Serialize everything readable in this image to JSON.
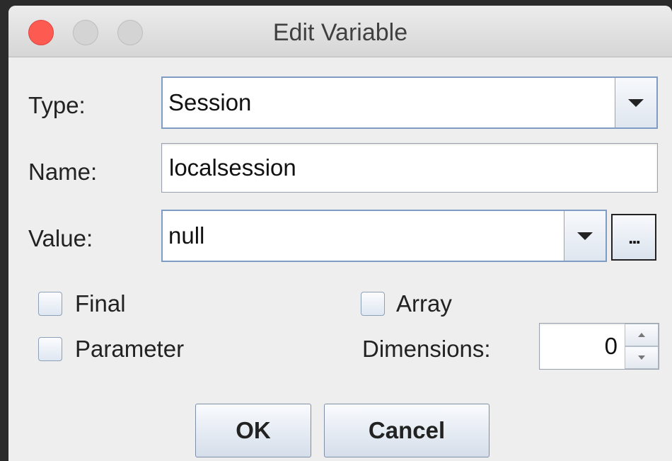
{
  "window": {
    "title": "Edit Variable"
  },
  "form": {
    "type_label": "Type:",
    "type_value": "Session",
    "name_label": "Name:",
    "name_value": "localsession",
    "value_label": "Value:",
    "value_value": "null",
    "ellipsis_label": "...",
    "final_label": "Final",
    "final_checked": false,
    "parameter_label": "Parameter",
    "parameter_checked": false,
    "array_label": "Array",
    "array_checked": false,
    "dimensions_label": "Dimensions:",
    "dimensions_value": "0"
  },
  "buttons": {
    "ok_label": "OK",
    "cancel_label": "Cancel"
  },
  "colors": {
    "close": "#fd5a52",
    "focus_border": "#7f9cc4"
  },
  "icons": {
    "dropdown": "chevron-down-icon",
    "spin_up": "arrow-up-icon",
    "spin_down": "arrow-down-icon"
  }
}
